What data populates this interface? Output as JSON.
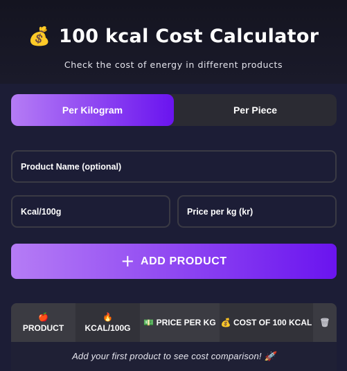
{
  "header": {
    "title_icon": "money-bag-icon",
    "title": "100 kcal Cost Calculator",
    "subtitle": "Check the cost of energy in different products"
  },
  "tabs": [
    {
      "label": "Per Kilogram",
      "active": true
    },
    {
      "label": "Per Piece",
      "active": false
    }
  ],
  "form": {
    "product_name_placeholder": "Product Name (optional)",
    "kcal_placeholder": "Kcal/100g",
    "price_placeholder": "Price per kg (kr)",
    "add_button_label": "ADD PRODUCT",
    "add_button_icon": "plus-icon"
  },
  "table": {
    "columns": [
      {
        "icon": "apple-icon",
        "label": "PRODUCT"
      },
      {
        "icon": "fire-icon",
        "label": "KCAL/100G"
      },
      {
        "icon": "banknote-icon",
        "label": "PRICE PER KG"
      },
      {
        "icon": "coin-icon",
        "label": "COST OF 100 KCAL"
      },
      {
        "icon": "trash-icon",
        "label": ""
      }
    ],
    "empty_message": "Add your first product to see cost comparison! 🚀"
  },
  "colors": {
    "background": "#16172b",
    "accent_start": "#b57cf5",
    "accent_end": "#6a14ef",
    "surface": "#2b2b33",
    "border": "#3a3a44"
  }
}
